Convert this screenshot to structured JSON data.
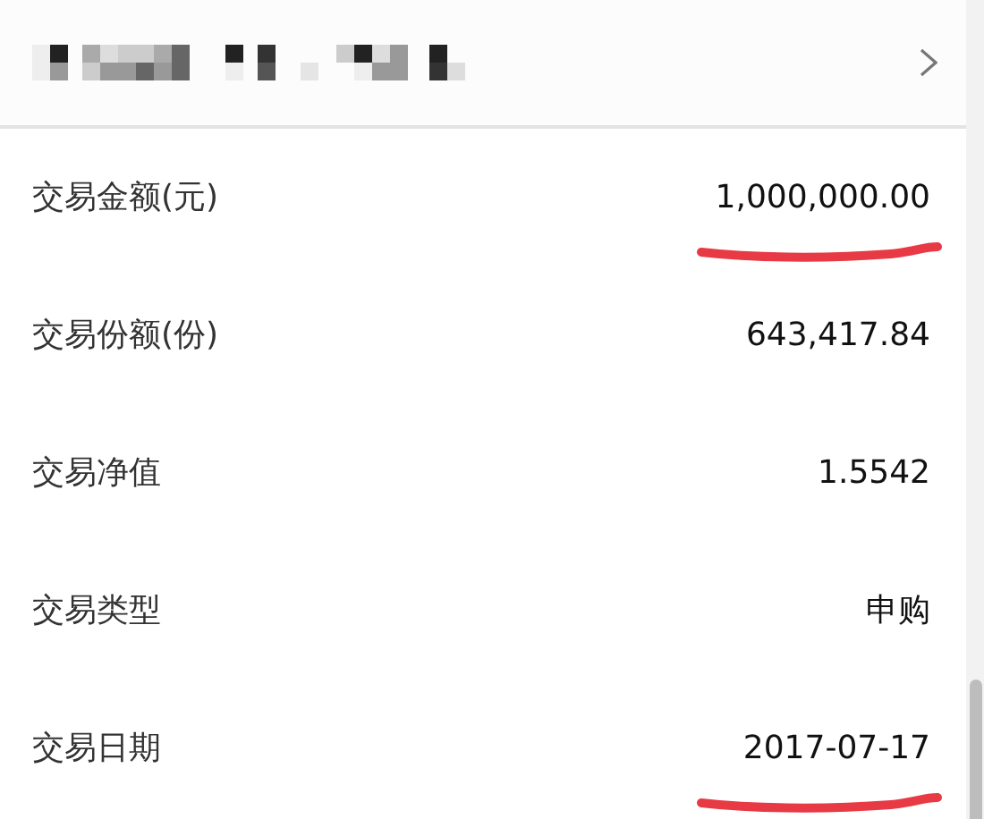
{
  "header": {
    "redacted": true
  },
  "rows": [
    {
      "label": "交易金额(元)",
      "value": "1,000,000.00",
      "underlined": true
    },
    {
      "label": "交易份额(份)",
      "value": "643,417.84",
      "underlined": false
    },
    {
      "label": "交易净值",
      "value": "1.5542",
      "underlined": false
    },
    {
      "label": "交易类型",
      "value": "申购",
      "underlined": false
    },
    {
      "label": "交易日期",
      "value": "2017-07-17",
      "underlined": true
    }
  ]
}
